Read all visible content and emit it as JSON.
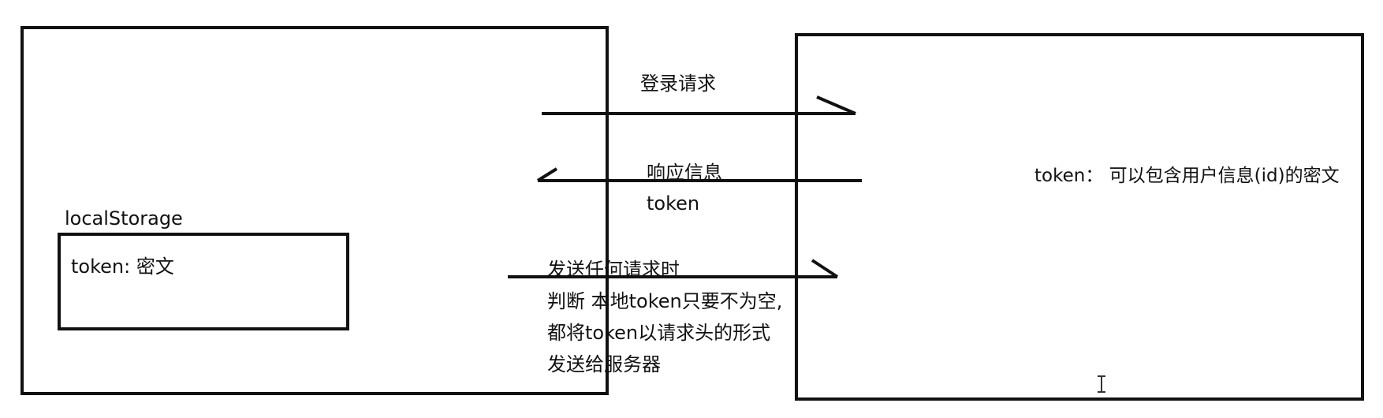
{
  "client": {
    "storage_label": "localStorage",
    "storage_content": "token: 密文"
  },
  "server": {
    "token_description": "token： 可以包含用户信息(id)的密文"
  },
  "arrows": {
    "login_request": "登录请求",
    "response_line1": "响应信息",
    "response_line2": "token",
    "any_request_lines": [
      "发送任何请求时",
      "判断 本地token只要不为空,",
      "都将token以请求头的形式",
      "发送给服务器"
    ]
  },
  "colors": {
    "stroke": "#111111",
    "background": "#ffffff"
  },
  "cursor_icon": "text-cursor-icon"
}
